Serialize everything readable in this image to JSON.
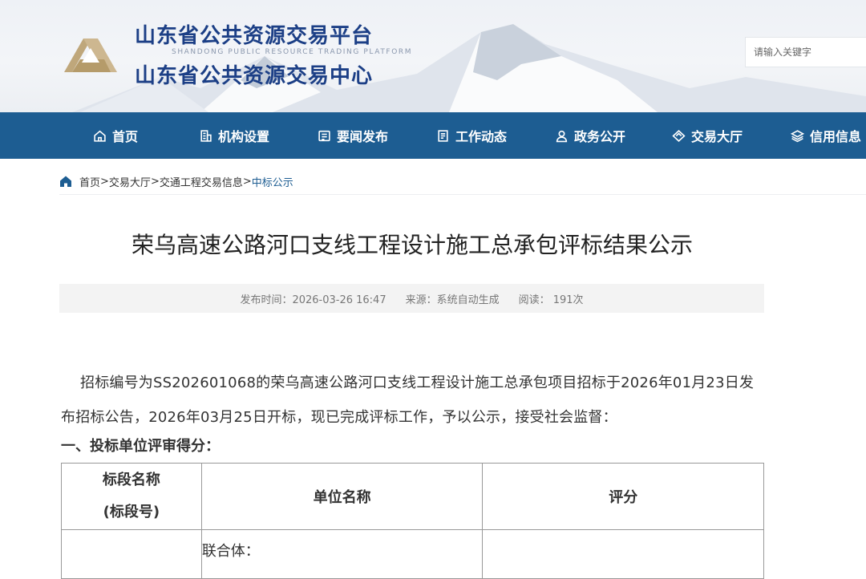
{
  "header": {
    "title": "山东省公共资源交易平台",
    "title_en": "SHANDONG PUBLIC RESOURCE TRADING PLATFORM",
    "subtitle": "山东省公共资源交易中心",
    "search_placeholder": "请输入关键字"
  },
  "nav": {
    "items": [
      {
        "label": "首页",
        "icon": "home-icon"
      },
      {
        "label": "机构设置",
        "icon": "building-icon"
      },
      {
        "label": "要闻发布",
        "icon": "news-icon"
      },
      {
        "label": "工作动态",
        "icon": "document-icon"
      },
      {
        "label": "政务公开",
        "icon": "user-icon"
      },
      {
        "label": "交易大厅",
        "icon": "diamond-icon"
      },
      {
        "label": "信用信息",
        "icon": "layers-icon"
      }
    ]
  },
  "breadcrumb": {
    "items": [
      "首页",
      "交易大厅",
      "交通工程交易信息",
      "中标公示"
    ],
    "separator": ">"
  },
  "article": {
    "title": "荣乌高速公路河口支线工程设计施工总承包评标结果公示",
    "publish_time_label": "发布时间：2026-03-26 16:47",
    "source_label": "来源：系统自动生成",
    "reads_label": "阅读： 191次",
    "paragraph": "招标编号为SS202601068的荣乌高速公路河口支线工程设计施工总承包项目招标于2026年01月23日发布招标公告，2026年03月25日开标，现已完成评标工作，予以公示，接受社会监督：",
    "section_heading": "一、投标单位评审得分："
  },
  "table": {
    "headers": {
      "segment_name": "标段名称",
      "segment_no": "(标段号)",
      "unit_name": "单位名称",
      "score": "评分"
    },
    "rows": [
      {
        "segment": "",
        "unit": "联合体：",
        "score": ""
      }
    ]
  },
  "colors": {
    "nav_bg": "#1d5d92",
    "title_blue": "#1c3f86",
    "breadcrumb_current": "#1d5d92",
    "logo_gold": "#bfa77b"
  }
}
